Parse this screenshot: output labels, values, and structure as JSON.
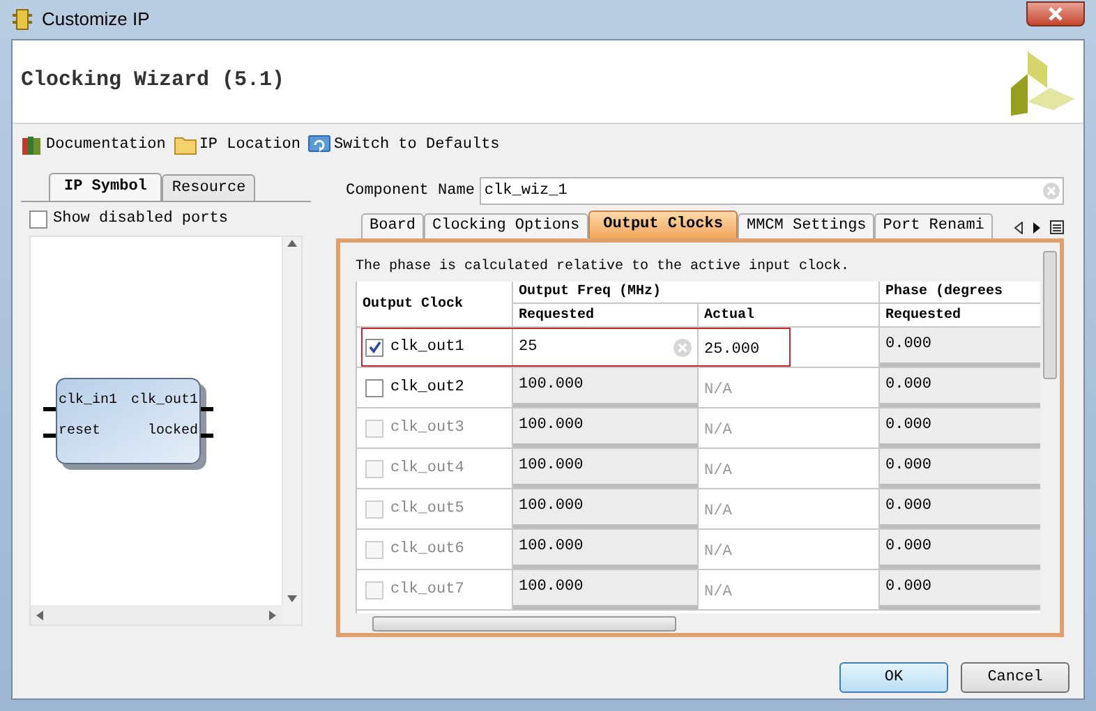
{
  "window": {
    "title": "Customize IP"
  },
  "header": {
    "title": "Clocking Wizard (5.1)"
  },
  "toolbar": [
    {
      "kind": "book",
      "label": "Documentation"
    },
    {
      "kind": "folder",
      "label": "IP Location"
    },
    {
      "kind": "refresh",
      "label": "Switch to Defaults"
    }
  ],
  "left_tabs": [
    {
      "label": "IP Symbol",
      "selected": true
    },
    {
      "label": "Resource",
      "selected": false
    }
  ],
  "show_disabled_ports": {
    "label": "Show disabled ports",
    "checked": false
  },
  "symbol": {
    "inputs": [
      "clk_in1",
      "reset"
    ],
    "outputs": [
      "clk_out1",
      "locked"
    ]
  },
  "component_name": {
    "label": "Component Name",
    "value": "clk_wiz_1"
  },
  "tabs": [
    {
      "label": "Board",
      "selected": false
    },
    {
      "label": "Clocking Options",
      "selected": false
    },
    {
      "label": "Output Clocks",
      "selected": true
    },
    {
      "label": "MMCM Settings",
      "selected": false
    },
    {
      "label": "Port Renami",
      "selected": false
    }
  ],
  "note": "The phase is calculated relative to the active input clock.",
  "table": {
    "columns": {
      "output_clock": "Output Clock",
      "output_freq": "Output Freq (MHz)",
      "freq_requested": "Requested",
      "freq_actual": "Actual",
      "phase": "Phase (degrees",
      "phase_requested": "Requested"
    },
    "rows": [
      {
        "name": "clk_out1",
        "checked": true,
        "disabled": false,
        "editing": true,
        "highlighted": true,
        "requested": "25",
        "actual": "25.000",
        "phase": "0.000"
      },
      {
        "name": "clk_out2",
        "checked": false,
        "disabled": false,
        "editing": false,
        "highlighted": false,
        "requested": "100.000",
        "actual": "N/A",
        "phase": "0.000"
      },
      {
        "name": "clk_out3",
        "checked": false,
        "disabled": true,
        "editing": false,
        "highlighted": false,
        "requested": "100.000",
        "actual": "N/A",
        "phase": "0.000"
      },
      {
        "name": "clk_out4",
        "checked": false,
        "disabled": true,
        "editing": false,
        "highlighted": false,
        "requested": "100.000",
        "actual": "N/A",
        "phase": "0.000"
      },
      {
        "name": "clk_out5",
        "checked": false,
        "disabled": true,
        "editing": false,
        "highlighted": false,
        "requested": "100.000",
        "actual": "N/A",
        "phase": "0.000"
      },
      {
        "name": "clk_out6",
        "checked": false,
        "disabled": true,
        "editing": false,
        "highlighted": false,
        "requested": "100.000",
        "actual": "N/A",
        "phase": "0.000"
      },
      {
        "name": "clk_out7",
        "checked": false,
        "disabled": true,
        "editing": false,
        "highlighted": false,
        "requested": "100.000",
        "actual": "N/A",
        "phase": "0.000"
      }
    ]
  },
  "buttons": [
    {
      "label": "OK",
      "default": true
    },
    {
      "label": "Cancel",
      "default": false
    }
  ]
}
